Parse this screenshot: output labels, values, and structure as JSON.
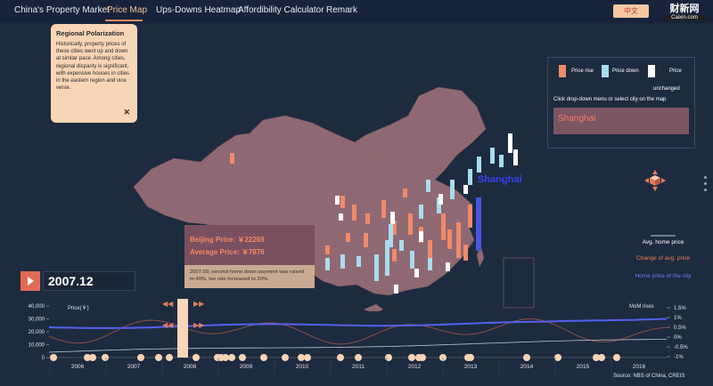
{
  "nav": {
    "tabs": [
      {
        "label": "China's Property Market"
      },
      {
        "label": "Price Map"
      },
      {
        "label": "Ups-Downs Heatmap"
      },
      {
        "label": "Affordibility Calculator"
      },
      {
        "label": "Remark"
      }
    ],
    "lang_button": "中文",
    "logo_cn": "财新网",
    "logo_en": "Caixin.com"
  },
  "info_card": {
    "title": "Regional Polarization",
    "body": "Historically, property prices of these cities went up and down at similar pace. Among cities, regional disparity is significant, with expensive houses in cities in the eastern region and vice verse.",
    "close": "✕"
  },
  "legend": {
    "rise": "Price rise",
    "down": "Price down",
    "unchanged_a": "Price",
    "unchanged_b": "unchanged",
    "hint": "Click drop-down menu or select city on the map",
    "selected_city": "Shanghai",
    "colors": {
      "rise": "#f08a6a",
      "down": "#a8dcec",
      "unchanged": "#ffffff"
    }
  },
  "map": {
    "city_label": "Shanghai"
  },
  "tooltip": {
    "beijing_price": "Beijing Price: ￥22269",
    "average_price": "Average Price: ￥7876",
    "note": "2007.09, second-home down payment was raised to 40%, tax rate increased to 20%."
  },
  "right_legend": {
    "avg": "Avg. home price",
    "change": "Change of avg. price",
    "home": "Home price of the city"
  },
  "date": "2007.12",
  "timeline": {
    "y_label": "Price(￥)",
    "right_label": "MoM rises",
    "y_ticks": [
      "40,000",
      "30,000",
      "20,000",
      "10,000",
      "0"
    ],
    "pct_ticks": [
      "1.5%",
      "1%",
      "0.5%",
      "0%",
      "-0.5%",
      "-1%"
    ],
    "years": [
      "2006",
      "2007",
      "2008",
      "2009",
      "2010",
      "2011",
      "2012",
      "2013",
      "2014",
      "2015",
      "2016"
    ],
    "policy_event_dates": [
      "2005.09",
      "2006.03",
      "2006.05",
      "2006.09",
      "2007.03",
      "2007.09",
      "2007.12",
      "2008.04",
      "2008.06",
      "2008.09",
      "2008.11",
      "2009.02",
      "2009.04",
      "2009.06",
      "2010.01",
      "2010.04",
      "2010.06",
      "2010.09",
      "2011.01",
      "2011.07",
      "2012.02",
      "2012.05",
      "2012.08",
      "2013.02",
      "2013.03",
      "2014.04",
      "2014.07",
      "2015.03",
      "2015.08",
      "2015.09",
      "2016.09"
    ]
  },
  "source": "Source: NBS of China, CREIS"
}
